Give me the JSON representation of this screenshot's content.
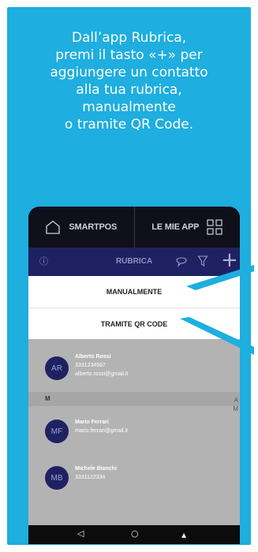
{
  "instruction": {
    "line1": "Dall’app Rubrica,",
    "line2": "premi il tasto «+» per",
    "line3": "aggiungere un contatto",
    "line4": "alla tua rubrica,",
    "line5": "manualmente",
    "line6": "o tramite QR Code."
  },
  "tabs": {
    "left_label": "SMARTPOS",
    "right_label": "LE MIE APP"
  },
  "appbar": {
    "title": "RUBRICA",
    "info_glyph": "ⓘ",
    "add_glyph": "+"
  },
  "sheet": {
    "option1": "MANUALMENTE",
    "option2": "TRAMITE QR CODE"
  },
  "contacts": [
    {
      "initials": "AR",
      "name": "Alberto Rossi",
      "phone": "3331234567",
      "email": "alberto.rossi@gmail.it"
    },
    {
      "initials": "MF",
      "name": "Mario Ferrari",
      "email": "mario.ferrari@gmail.it"
    },
    {
      "initials": "MB",
      "name": "Michele Bianchi",
      "phone": "3331122334"
    }
  ],
  "section_m": "M",
  "alpha_index": [
    "A",
    "M"
  ],
  "navbar": {
    "back": "◁",
    "home": "○",
    "recent": "▲"
  },
  "colors": {
    "card_bg": "#1eaedf",
    "appbar_bg": "#1f2262",
    "avatar_bg": "#1f2262",
    "list_bg": "#b3b3b3"
  }
}
